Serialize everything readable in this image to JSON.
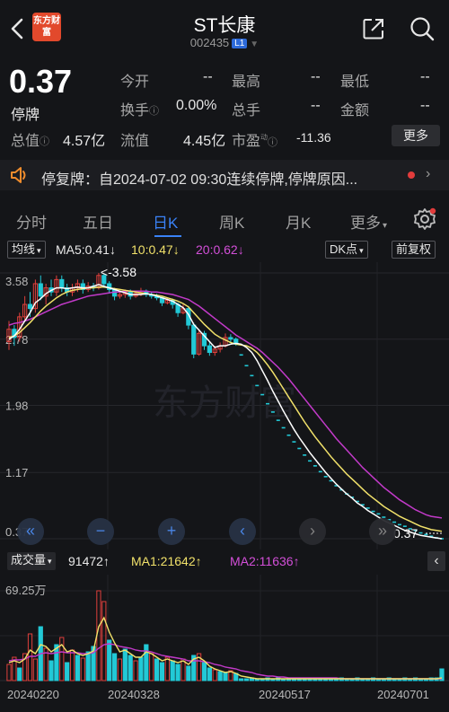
{
  "header": {
    "logo_text": "东方财富",
    "title": "ST长康",
    "code": "002435",
    "level": "L1"
  },
  "quote": {
    "price": "0.37",
    "status": "停牌",
    "fields": [
      {
        "label": "今开",
        "value": "--"
      },
      {
        "label": "最高",
        "value": "--"
      },
      {
        "label": "最低",
        "value": "--"
      },
      {
        "label": "换手",
        "value": "0.00%"
      },
      {
        "label": "总手",
        "value": "--"
      },
      {
        "label": "金额",
        "value": "--"
      },
      {
        "label": "总值",
        "value": "4.57亿"
      },
      {
        "label": "流值",
        "value": "4.45亿"
      },
      {
        "label": "市盈",
        "value": "-11.36"
      }
    ],
    "more_label": "更多",
    "pe_sup": "动"
  },
  "notice": {
    "text": "停复牌：自2024-07-02 09:30连续停牌,停牌原因..."
  },
  "tabs": [
    {
      "label": "分时",
      "active": false
    },
    {
      "label": "五日",
      "active": false
    },
    {
      "label": "日K",
      "active": true
    },
    {
      "label": "周K",
      "active": false
    },
    {
      "label": "月K",
      "active": false
    },
    {
      "label": "更多",
      "active": false
    }
  ],
  "indicators": {
    "ma_button": "均线",
    "ma5": "MA5:0.41",
    "ma10": "10:0.47",
    "ma20": "20:0.62",
    "dk_button": "DK点",
    "adjust_button": "前复权"
  },
  "volume_header": {
    "selector": "成交量",
    "vol": "91472",
    "ma1": "MA1:21642",
    "ma2": "MA2:11636",
    "max_label": "69.25万"
  },
  "colors": {
    "up": "#e0403c",
    "down": "#22c9d6",
    "ma5": "#ffffff",
    "ma10": "#f1e16a",
    "ma20": "#c23ac9",
    "accent": "#3a82f7"
  },
  "chart_data": {
    "type": "candlestick",
    "y_ticks": [
      "3.58",
      "2.78",
      "1.98",
      "1.17",
      "0.37"
    ],
    "ylim": [
      0.37,
      3.58
    ],
    "x_tick_labels": [
      "20240220",
      "20240328",
      "20240517",
      "20240701"
    ],
    "max_marker": "<-3.58",
    "last_marker": "0.37",
    "watermark": "东方财富",
    "candles": [
      [
        2.75,
        2.9,
        3.0,
        2.65
      ],
      [
        2.9,
        2.8,
        2.95,
        2.7
      ],
      [
        2.8,
        3.05,
        3.1,
        2.75
      ],
      [
        3.05,
        3.2,
        3.3,
        3.0
      ],
      [
        3.2,
        3.15,
        3.35,
        3.05
      ],
      [
        3.15,
        3.45,
        3.5,
        3.1
      ],
      [
        3.45,
        3.3,
        3.55,
        3.25
      ],
      [
        3.3,
        3.4,
        3.45,
        3.2
      ],
      [
        3.4,
        3.35,
        3.5,
        3.3
      ],
      [
        3.35,
        3.5,
        3.55,
        3.3
      ],
      [
        3.5,
        3.4,
        3.55,
        3.35
      ],
      [
        3.4,
        3.35,
        3.45,
        3.3
      ],
      [
        3.35,
        3.4,
        3.45,
        3.3
      ],
      [
        3.4,
        3.45,
        3.5,
        3.35
      ],
      [
        3.45,
        3.38,
        3.5,
        3.33
      ],
      [
        3.38,
        3.42,
        3.47,
        3.35
      ],
      [
        3.42,
        3.4,
        3.46,
        3.36
      ],
      [
        3.4,
        3.55,
        3.58,
        3.38
      ],
      [
        3.55,
        3.45,
        3.57,
        3.4
      ],
      [
        3.45,
        3.38,
        3.48,
        3.33
      ],
      [
        3.38,
        3.3,
        3.4,
        3.25
      ],
      [
        3.3,
        3.32,
        3.36,
        3.27
      ],
      [
        3.32,
        3.35,
        3.38,
        3.28
      ],
      [
        3.35,
        3.3,
        3.38,
        3.26
      ],
      [
        3.3,
        3.33,
        3.36,
        3.28
      ],
      [
        3.33,
        3.36,
        3.4,
        3.3
      ],
      [
        3.36,
        3.32,
        3.38,
        3.29
      ],
      [
        3.32,
        3.3,
        3.35,
        3.27
      ],
      [
        3.3,
        3.28,
        3.33,
        3.25
      ],
      [
        3.28,
        3.22,
        3.3,
        3.18
      ],
      [
        3.22,
        3.25,
        3.28,
        3.2
      ],
      [
        3.25,
        3.2,
        3.27,
        3.15
      ],
      [
        3.2,
        3.1,
        3.22,
        3.05
      ],
      [
        3.1,
        3.15,
        3.2,
        3.08
      ],
      [
        3.15,
        2.95,
        3.18,
        2.9
      ],
      [
        2.95,
        2.6,
        2.98,
        2.55
      ],
      [
        2.6,
        2.85,
        2.9,
        2.58
      ],
      [
        2.85,
        2.7,
        2.88,
        2.65
      ],
      [
        2.7,
        2.62,
        2.75,
        2.58
      ],
      [
        2.62,
        2.66,
        2.7,
        2.58
      ],
      [
        2.66,
        2.7,
        2.74,
        2.62
      ],
      [
        2.7,
        2.8,
        2.85,
        2.68
      ],
      [
        2.8,
        2.78,
        2.84,
        2.74
      ],
      [
        2.78,
        2.72,
        2.8,
        2.7
      ]
    ],
    "limit_down_dots": [
      2.59,
      2.46,
      2.34,
      2.22,
      2.11,
      2.0,
      1.9,
      1.8,
      1.71,
      1.62,
      1.54,
      1.46,
      1.38,
      1.31,
      1.25,
      1.18,
      1.12,
      1.07,
      1.01,
      0.96,
      0.91,
      0.87,
      0.82,
      0.78,
      0.74,
      0.7,
      0.67,
      0.63,
      0.6,
      0.57,
      0.54,
      0.52,
      0.49,
      0.47,
      0.44,
      0.42,
      0.4,
      0.38,
      0.37
    ],
    "ma5": [
      2.78,
      2.82,
      2.9,
      3.0,
      3.1,
      3.22,
      3.27,
      3.33,
      3.37,
      3.4,
      3.4,
      3.39,
      3.4,
      3.41,
      3.4,
      3.4,
      3.42,
      3.44,
      3.42,
      3.4,
      3.38,
      3.36,
      3.34,
      3.32,
      3.32,
      3.32,
      3.33,
      3.32,
      3.3,
      3.28,
      3.26,
      3.24,
      3.2,
      3.16,
      3.08,
      2.96,
      2.89,
      2.82,
      2.75,
      2.68,
      2.7,
      2.7,
      2.72,
      2.73,
      2.72,
      2.68,
      2.62,
      2.52,
      2.4,
      2.28,
      2.15,
      2.03,
      1.91,
      1.8,
      1.69,
      1.59,
      1.5,
      1.41,
      1.33,
      1.25,
      1.17,
      1.1,
      1.03,
      0.97,
      0.91,
      0.86,
      0.8,
      0.76,
      0.71,
      0.67,
      0.63,
      0.59,
      0.56,
      0.53,
      0.5,
      0.47,
      0.45,
      0.43,
      0.41,
      0.4,
      0.39,
      0.38,
      0.37
    ],
    "ma10": [
      2.8,
      2.82,
      2.86,
      2.92,
      2.98,
      3.05,
      3.12,
      3.18,
      3.23,
      3.28,
      3.32,
      3.35,
      3.37,
      3.38,
      3.39,
      3.4,
      3.4,
      3.41,
      3.41,
      3.4,
      3.39,
      3.38,
      3.37,
      3.36,
      3.35,
      3.34,
      3.33,
      3.32,
      3.31,
      3.3,
      3.28,
      3.26,
      3.24,
      3.21,
      3.17,
      3.1,
      3.03,
      2.96,
      2.9,
      2.84,
      2.8,
      2.77,
      2.74,
      2.72,
      2.71,
      2.7,
      2.67,
      2.62,
      2.55,
      2.47,
      2.38,
      2.28,
      2.18,
      2.08,
      1.98,
      1.88,
      1.78,
      1.69,
      1.6,
      1.52,
      1.44,
      1.36,
      1.29,
      1.22,
      1.15,
      1.09,
      1.03,
      0.97,
      0.91,
      0.86,
      0.81,
      0.76,
      0.72,
      0.68,
      0.64,
      0.61,
      0.58,
      0.55,
      0.52,
      0.5,
      0.48,
      0.47,
      0.46
    ],
    "ma20": [
      2.95,
      2.97,
      2.98,
      3.0,
      3.02,
      3.05,
      3.08,
      3.11,
      3.14,
      3.17,
      3.2,
      3.22,
      3.24,
      3.26,
      3.28,
      3.3,
      3.31,
      3.32,
      3.33,
      3.34,
      3.35,
      3.35,
      3.36,
      3.36,
      3.36,
      3.36,
      3.36,
      3.35,
      3.35,
      3.34,
      3.33,
      3.32,
      3.3,
      3.28,
      3.26,
      3.22,
      3.18,
      3.13,
      3.08,
      3.03,
      2.98,
      2.93,
      2.88,
      2.83,
      2.79,
      2.75,
      2.71,
      2.67,
      2.62,
      2.56,
      2.5,
      2.44,
      2.37,
      2.3,
      2.22,
      2.14,
      2.06,
      1.98,
      1.9,
      1.82,
      1.74,
      1.66,
      1.58,
      1.51,
      1.44,
      1.37,
      1.3,
      1.23,
      1.17,
      1.11,
      1.05,
      0.99,
      0.94,
      0.89,
      0.84,
      0.8,
      0.76,
      0.72,
      0.69,
      0.66,
      0.64,
      0.63,
      0.62
    ],
    "volumes": [
      18,
      26,
      14,
      30,
      52,
      24,
      60,
      36,
      22,
      40,
      48,
      20,
      34,
      28,
      25,
      32,
      38,
      100,
      88,
      45,
      30,
      24,
      35,
      28,
      22,
      26,
      40,
      30,
      24,
      20,
      26,
      22,
      18,
      24,
      16,
      28,
      30,
      20,
      14,
      12,
      10,
      9,
      11,
      8,
      2,
      2,
      3,
      2,
      2,
      3,
      2,
      3,
      2,
      2,
      3,
      2,
      2,
      3,
      2,
      2,
      3,
      2,
      2,
      3,
      2,
      2,
      3,
      2,
      2,
      3,
      2,
      2,
      3,
      2,
      2,
      3,
      2,
      3,
      2,
      2,
      3,
      3,
      13
    ],
    "volume_up": [
      true,
      true,
      false,
      true,
      true,
      true,
      false,
      true,
      false,
      false,
      true,
      false,
      true,
      false,
      true,
      false,
      false,
      true,
      true,
      false,
      false,
      true,
      false,
      false,
      true,
      false,
      false,
      true,
      false,
      false,
      true,
      false,
      false,
      true,
      false,
      false,
      true,
      false,
      false,
      true,
      false,
      false,
      true,
      false,
      false,
      false,
      false,
      false,
      false,
      false,
      false,
      false,
      false,
      false,
      false,
      false,
      false,
      false,
      false,
      false,
      false,
      false,
      false,
      false,
      false,
      false,
      false,
      false,
      false,
      false,
      false,
      false,
      false,
      false,
      false,
      false,
      false,
      false,
      false,
      false,
      false,
      false,
      false
    ],
    "vol_ma1": [
      20,
      22,
      20,
      24,
      34,
      30,
      40,
      38,
      32,
      36,
      40,
      32,
      34,
      30,
      28,
      30,
      33,
      60,
      70,
      54,
      42,
      32,
      34,
      30,
      26,
      26,
      32,
      30,
      26,
      22,
      24,
      22,
      20,
      22,
      18,
      24,
      26,
      22,
      16,
      13,
      11,
      9,
      10,
      8,
      5,
      4,
      3,
      2,
      2,
      2,
      2,
      2,
      2,
      2,
      2,
      2,
      2,
      2,
      2,
      2,
      2,
      2,
      2,
      2,
      2,
      2,
      2,
      2,
      2,
      2,
      2,
      2,
      2,
      2,
      2,
      2,
      2,
      2,
      2,
      2,
      2,
      2,
      3
    ],
    "vol_ma2": [
      22,
      23,
      23,
      24,
      27,
      27,
      30,
      31,
      30,
      31,
      32,
      31,
      31,
      31,
      30,
      30,
      31,
      36,
      40,
      41,
      40,
      38,
      37,
      36,
      34,
      33,
      33,
      32,
      30,
      28,
      27,
      26,
      25,
      24,
      22,
      22,
      22,
      21,
      20,
      18,
      17,
      15,
      14,
      13,
      11,
      10,
      9,
      7,
      6,
      5,
      5,
      4,
      4,
      3,
      3,
      3,
      3,
      3,
      3,
      3,
      3,
      3,
      3,
      2,
      2,
      2,
      2,
      2,
      2,
      2,
      2,
      2,
      2,
      2,
      2,
      2,
      2,
      2,
      2,
      2,
      2,
      2,
      2
    ]
  }
}
